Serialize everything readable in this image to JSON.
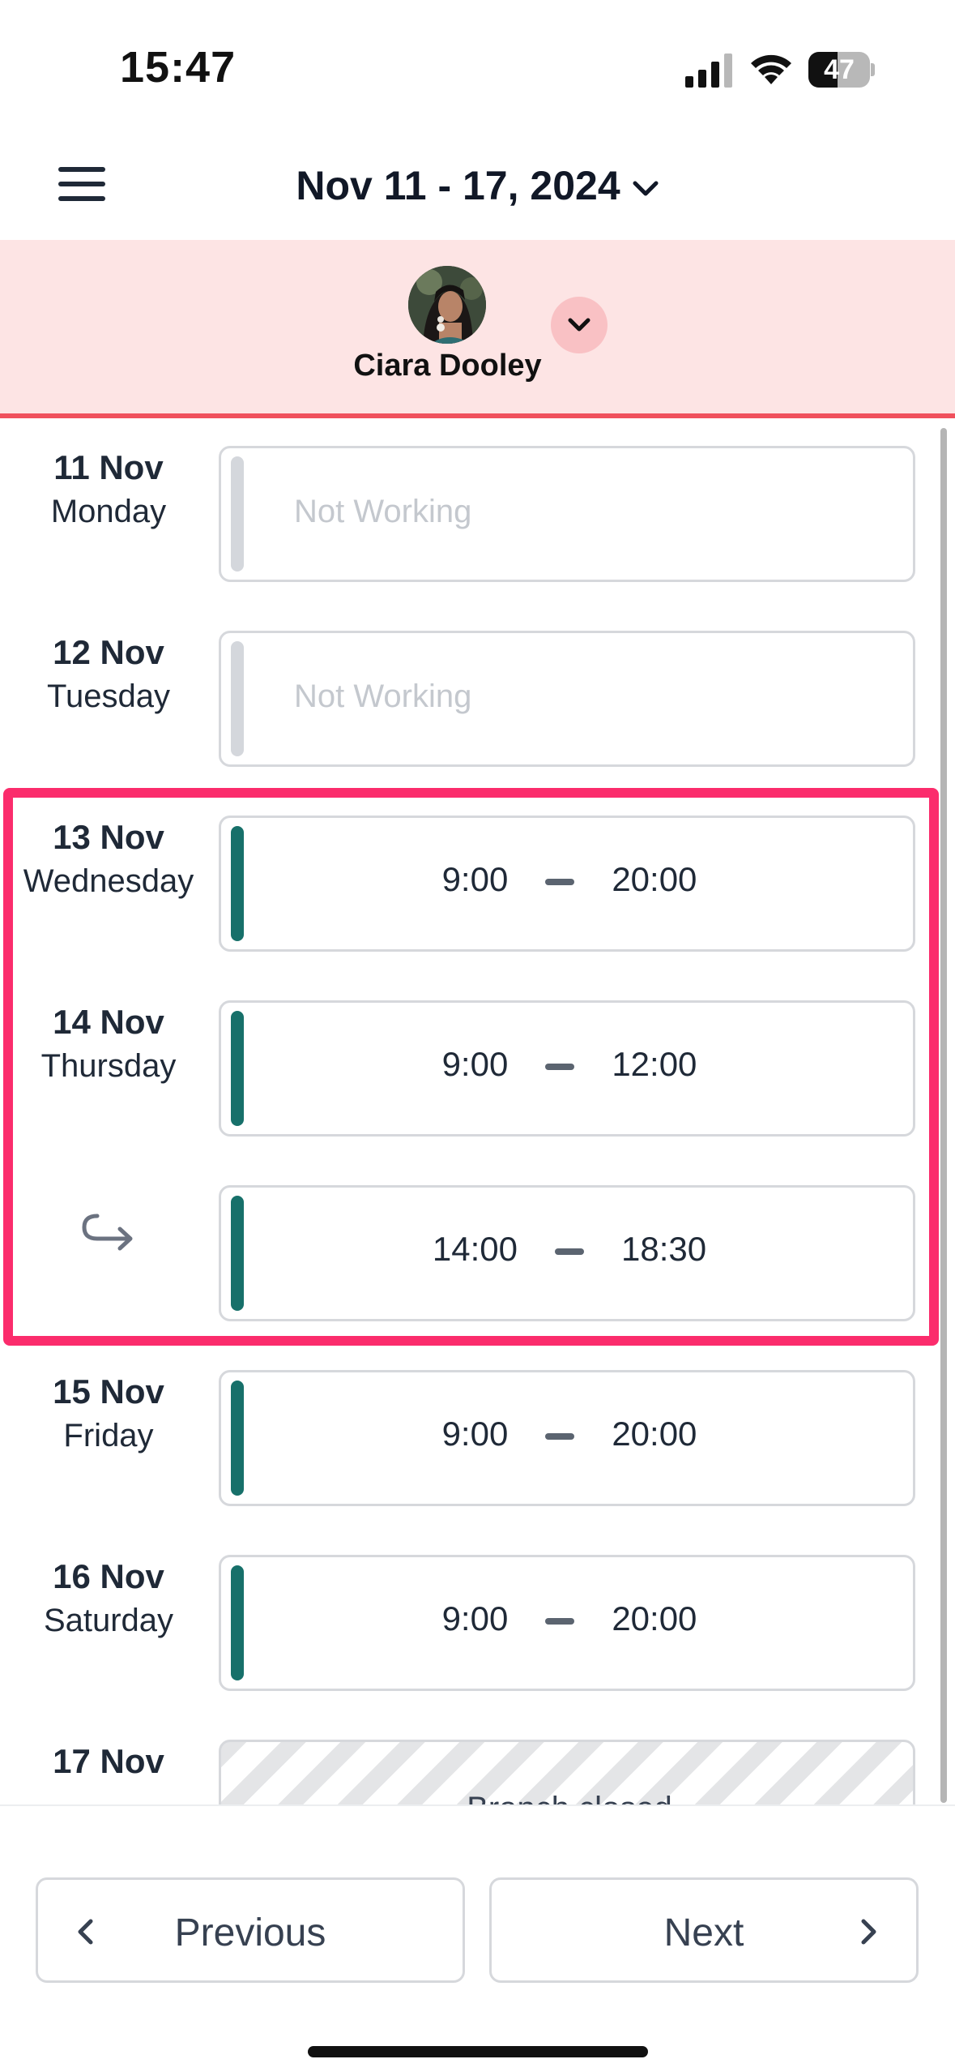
{
  "status_bar": {
    "time": "15:47",
    "battery": "47",
    "battery_level": 0.47
  },
  "header": {
    "date_range": "Nov 11 - 17, 2024"
  },
  "staff": {
    "name": "Ciara Dooley"
  },
  "days": [
    {
      "date": "11 Nov",
      "weekday": "Monday",
      "status": "Not Working"
    },
    {
      "date": "12 Nov",
      "weekday": "Tuesday",
      "status": "Not Working"
    },
    {
      "date": "13 Nov",
      "weekday": "Wednesday",
      "start": "9:00",
      "end": "20:00"
    },
    {
      "date": "14 Nov",
      "weekday": "Thursday",
      "start": "9:00",
      "end": "12:00"
    },
    {
      "split_start": "14:00",
      "split_end": "18:30"
    },
    {
      "date": "15 Nov",
      "weekday": "Friday",
      "start": "9:00",
      "end": "20:00"
    },
    {
      "date": "16 Nov",
      "weekday": "Saturday",
      "start": "9:00",
      "end": "20:00"
    },
    {
      "date": "17 Nov",
      "status": "Branch closed"
    }
  ],
  "footer": {
    "previous_label": "Previous",
    "next_label": "Next"
  },
  "colors": {
    "accent_working": "#17706a",
    "accent_off": "#d4d7dc",
    "highlight": "#fb2c6c",
    "profile_band": "#fde4e4"
  }
}
